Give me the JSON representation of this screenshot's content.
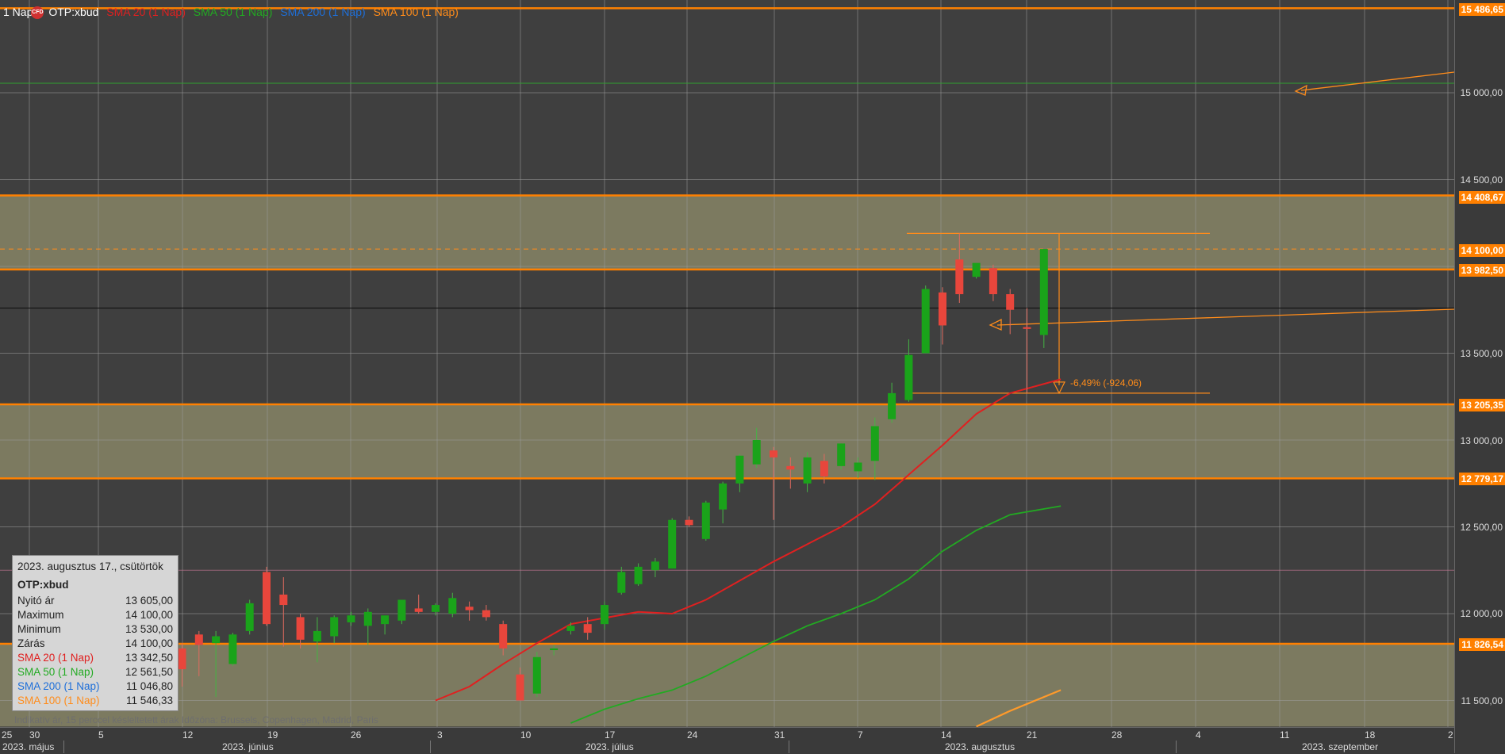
{
  "header": {
    "timeframe": "1 Nap",
    "badge": "CFD",
    "symbol": "OTP:xbud",
    "indicators": [
      {
        "label": "SMA 20 (1 Nap)",
        "color": "#e02020"
      },
      {
        "label": "SMA 50 (1 Nap)",
        "color": "#22aa22"
      },
      {
        "label": "SMA 200 (1 Nap)",
        "color": "#1e6fd9"
      },
      {
        "label": "SMA 100 (1 Nap)",
        "color": "#ff8c1a"
      }
    ]
  },
  "price_axis": {
    "ticks": [
      "15 000,00",
      "14 500,00",
      "13 500,00",
      "13 000,00",
      "12 500,00",
      "12 000,00",
      "11 500,00"
    ],
    "badges": [
      "15 486,65",
      "14 408,67",
      "14 100,00",
      "13 982,50",
      "13 205,35",
      "12 779,17",
      "11 826,54"
    ]
  },
  "time_axis": {
    "days": [
      "25",
      "30",
      "5",
      "12",
      "19",
      "26",
      "3",
      "10",
      "17",
      "24",
      "31",
      "7",
      "14",
      "21",
      "28",
      "4",
      "11",
      "18",
      "2"
    ],
    "months": [
      "2023. május",
      "2023. június",
      "2023. július",
      "2023. augusztus",
      "2023. szeptember"
    ]
  },
  "annotations": {
    "measure_label": "-6,49% (-924,06)"
  },
  "infobox": {
    "date": "2023. augusztus 17., csütörtök",
    "symbol": "OTP:xbud",
    "rows": [
      {
        "label": "Nyitó ár",
        "value": "13 605,00"
      },
      {
        "label": "Maximum",
        "value": "14 100,00"
      },
      {
        "label": "Minimum",
        "value": "13 530,00"
      },
      {
        "label": "Zárás",
        "value": "14 100,00"
      },
      {
        "label": "SMA 20 (1 Nap)",
        "value": "13 342,50",
        "color": "#e02020"
      },
      {
        "label": "SMA 50 (1 Nap)",
        "value": "12 561,50",
        "color": "#22aa22"
      },
      {
        "label": "SMA 200 (1 Nap)",
        "value": "11 046,80",
        "color": "#1e6fd9"
      },
      {
        "label": "SMA 100 (1 Nap)",
        "value": "11 546,33",
        "color": "#ff8c1a"
      }
    ]
  },
  "footer": "Indikatív ár, 15 perccel késleltetett árak    Időzóna: Brussels, Copenhagen, Madrid, Paris",
  "chart_data": {
    "type": "candlestick",
    "symbol": "OTP:xbud",
    "ylim": [
      11350,
      15520
    ],
    "bands": [
      [
        14408.67,
        13982.5
      ],
      [
        13205.35,
        12779.17
      ],
      [
        11826.54,
        11350
      ]
    ],
    "levels": [
      15486.65,
      14408.67,
      13982.5,
      13205.35,
      12779.17,
      11826.54
    ],
    "candles": [
      {
        "o": 11800,
        "h": 11830,
        "l": 11580,
        "c": 11680
      },
      {
        "o": 11880,
        "h": 11900,
        "l": 11640,
        "c": 11820
      },
      {
        "o": 11830,
        "h": 11900,
        "l": 11520,
        "c": 11870
      },
      {
        "o": 11710,
        "h": 11890,
        "l": 11700,
        "c": 11880
      },
      {
        "o": 11900,
        "h": 12080,
        "l": 11880,
        "c": 12060
      },
      {
        "o": 12240,
        "h": 12270,
        "l": 11930,
        "c": 11940
      },
      {
        "o": 12110,
        "h": 12210,
        "l": 11810,
        "c": 12050
      },
      {
        "o": 11980,
        "h": 12000,
        "l": 11800,
        "c": 11850
      },
      {
        "o": 11840,
        "h": 11980,
        "l": 11720,
        "c": 11900
      },
      {
        "o": 11870,
        "h": 11990,
        "l": 11830,
        "c": 11980
      },
      {
        "o": 11950,
        "h": 12010,
        "l": 11930,
        "c": 11990
      },
      {
        "o": 11930,
        "h": 12030,
        "l": 11820,
        "c": 12010
      },
      {
        "o": 11940,
        "h": 11970,
        "l": 11880,
        "c": 11990
      },
      {
        "o": 11960,
        "h": 12080,
        "l": 11940,
        "c": 12080
      },
      {
        "o": 12030,
        "h": 12110,
        "l": 12000,
        "c": 12010
      },
      {
        "o": 12010,
        "h": 12060,
        "l": 11990,
        "c": 12050
      },
      {
        "o": 12000,
        "h": 12120,
        "l": 11980,
        "c": 12090
      },
      {
        "o": 12040,
        "h": 12070,
        "l": 11960,
        "c": 12020
      },
      {
        "o": 12020,
        "h": 12050,
        "l": 11960,
        "c": 11980
      },
      {
        "o": 11940,
        "h": 11960,
        "l": 11760,
        "c": 11800
      },
      {
        "o": 11650,
        "h": 11690,
        "l": 11500,
        "c": 11500
      },
      {
        "o": 11540,
        "h": 11780,
        "l": 11520,
        "c": 11750
      },
      {
        "o": 11790,
        "h": 11820,
        "l": 11760,
        "c": 11800
      },
      {
        "o": 11900,
        "h": 11950,
        "l": 11880,
        "c": 11930
      },
      {
        "o": 11940,
        "h": 11980,
        "l": 11850,
        "c": 11890
      },
      {
        "o": 11940,
        "h": 12070,
        "l": 11910,
        "c": 12050
      },
      {
        "o": 12120,
        "h": 12270,
        "l": 12110,
        "c": 12240
      },
      {
        "o": 12170,
        "h": 12290,
        "l": 12160,
        "c": 12270
      },
      {
        "o": 12250,
        "h": 12320,
        "l": 12210,
        "c": 12300
      },
      {
        "o": 12260,
        "h": 12550,
        "l": 12260,
        "c": 12540
      },
      {
        "o": 12540,
        "h": 12560,
        "l": 12500,
        "c": 12510
      },
      {
        "o": 12430,
        "h": 12650,
        "l": 12420,
        "c": 12640
      },
      {
        "o": 12600,
        "h": 12760,
        "l": 12520,
        "c": 12750
      },
      {
        "o": 12750,
        "h": 12920,
        "l": 12700,
        "c": 12910
      },
      {
        "o": 12860,
        "h": 13070,
        "l": 12840,
        "c": 13000
      },
      {
        "o": 12940,
        "h": 12960,
        "l": 12540,
        "c": 12900
      },
      {
        "o": 12850,
        "h": 12900,
        "l": 12720,
        "c": 12830
      },
      {
        "o": 12750,
        "h": 12930,
        "l": 12700,
        "c": 12900
      },
      {
        "o": 12880,
        "h": 12920,
        "l": 12750,
        "c": 12790
      },
      {
        "o": 12850,
        "h": 12980,
        "l": 12830,
        "c": 12980
      },
      {
        "o": 12820,
        "h": 12900,
        "l": 12780,
        "c": 12870
      },
      {
        "o": 12880,
        "h": 13130,
        "l": 12770,
        "c": 13080
      },
      {
        "o": 13120,
        "h": 13330,
        "l": 13100,
        "c": 13270
      },
      {
        "o": 13230,
        "h": 13580,
        "l": 13220,
        "c": 13490
      },
      {
        "o": 13500,
        "h": 13890,
        "l": 13500,
        "c": 13870
      },
      {
        "o": 13850,
        "h": 13880,
        "l": 13550,
        "c": 13660
      },
      {
        "o": 14040,
        "h": 14190,
        "l": 13790,
        "c": 13840
      },
      {
        "o": 13940,
        "h": 14020,
        "l": 13930,
        "c": 14020
      },
      {
        "o": 13990,
        "h": 14010,
        "l": 13800,
        "c": 13840
      },
      {
        "o": 13840,
        "h": 13870,
        "l": 13610,
        "c": 13750
      },
      {
        "o": 13650,
        "h": 13760,
        "l": 13270,
        "c": 13640
      },
      {
        "o": 13605,
        "h": 14100,
        "l": 13530,
        "c": 14100
      }
    ],
    "sma20": [
      [
        21,
        11500
      ],
      [
        23,
        11580
      ],
      [
        25,
        11710
      ],
      [
        27,
        11830
      ],
      [
        29,
        11940
      ],
      [
        33,
        12010
      ],
      [
        35,
        12000
      ],
      [
        37,
        12080
      ],
      [
        39,
        12190
      ],
      [
        41,
        12300
      ],
      [
        43,
        12400
      ],
      [
        45,
        12500
      ],
      [
        47,
        12630
      ],
      [
        49,
        12800
      ],
      [
        51,
        12970
      ],
      [
        53,
        13150
      ],
      [
        55,
        13270
      ],
      [
        58,
        13350
      ]
    ],
    "sma50": [
      [
        29,
        11370
      ],
      [
        31,
        11450
      ],
      [
        33,
        11510
      ],
      [
        35,
        11560
      ],
      [
        37,
        11640
      ],
      [
        39,
        11740
      ],
      [
        41,
        11840
      ],
      [
        43,
        11930
      ],
      [
        45,
        12000
      ],
      [
        47,
        12080
      ],
      [
        49,
        12200
      ],
      [
        51,
        12360
      ],
      [
        53,
        12480
      ],
      [
        55,
        12570
      ],
      [
        58,
        12620
      ]
    ],
    "sma100": [
      [
        53,
        11350
      ],
      [
        55,
        11440
      ],
      [
        58,
        11560
      ]
    ]
  }
}
